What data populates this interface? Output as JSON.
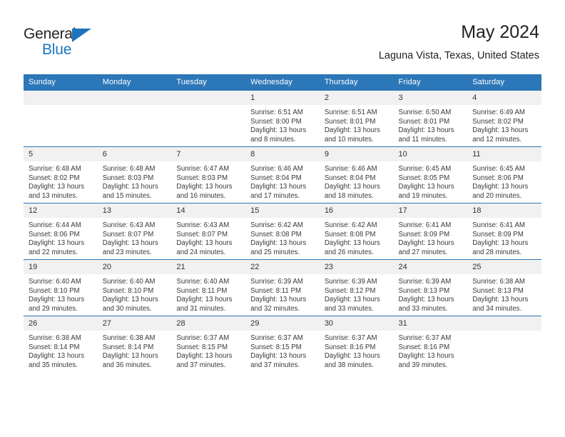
{
  "brand": {
    "name_part1": "General",
    "name_part2": "Blue",
    "color_primary": "#1c75bc",
    "color_text": "#231f20"
  },
  "header": {
    "title": "May 2024",
    "subtitle": "Laguna Vista, Texas, United States",
    "header_bg": "#2c77b8",
    "daynum_bg": "#f1f1f1"
  },
  "weekday_headers": [
    "Sunday",
    "Monday",
    "Tuesday",
    "Wednesday",
    "Thursday",
    "Friday",
    "Saturday"
  ],
  "labels": {
    "sunrise_prefix": "Sunrise:",
    "sunset_prefix": "Sunset:",
    "daylight_prefix": "Daylight:"
  },
  "weeks": [
    [
      {
        "day": "",
        "blank": true,
        "sunrise": "",
        "sunset": "",
        "daylight_line1": "",
        "daylight_line2": ""
      },
      {
        "day": "",
        "blank": true,
        "sunrise": "",
        "sunset": "",
        "daylight_line1": "",
        "daylight_line2": ""
      },
      {
        "day": "",
        "blank": true,
        "sunrise": "",
        "sunset": "",
        "daylight_line1": "",
        "daylight_line2": ""
      },
      {
        "day": "1",
        "blank": false,
        "sunrise": "Sunrise: 6:51 AM",
        "sunset": "Sunset: 8:00 PM",
        "daylight_line1": "Daylight: 13 hours",
        "daylight_line2": "and 8 minutes."
      },
      {
        "day": "2",
        "blank": false,
        "sunrise": "Sunrise: 6:51 AM",
        "sunset": "Sunset: 8:01 PM",
        "daylight_line1": "Daylight: 13 hours",
        "daylight_line2": "and 10 minutes."
      },
      {
        "day": "3",
        "blank": false,
        "sunrise": "Sunrise: 6:50 AM",
        "sunset": "Sunset: 8:01 PM",
        "daylight_line1": "Daylight: 13 hours",
        "daylight_line2": "and 11 minutes."
      },
      {
        "day": "4",
        "blank": false,
        "sunrise": "Sunrise: 6:49 AM",
        "sunset": "Sunset: 8:02 PM",
        "daylight_line1": "Daylight: 13 hours",
        "daylight_line2": "and 12 minutes."
      }
    ],
    [
      {
        "day": "5",
        "blank": false,
        "sunrise": "Sunrise: 6:48 AM",
        "sunset": "Sunset: 8:02 PM",
        "daylight_line1": "Daylight: 13 hours",
        "daylight_line2": "and 13 minutes."
      },
      {
        "day": "6",
        "blank": false,
        "sunrise": "Sunrise: 6:48 AM",
        "sunset": "Sunset: 8:03 PM",
        "daylight_line1": "Daylight: 13 hours",
        "daylight_line2": "and 15 minutes."
      },
      {
        "day": "7",
        "blank": false,
        "sunrise": "Sunrise: 6:47 AM",
        "sunset": "Sunset: 8:03 PM",
        "daylight_line1": "Daylight: 13 hours",
        "daylight_line2": "and 16 minutes."
      },
      {
        "day": "8",
        "blank": false,
        "sunrise": "Sunrise: 6:46 AM",
        "sunset": "Sunset: 8:04 PM",
        "daylight_line1": "Daylight: 13 hours",
        "daylight_line2": "and 17 minutes."
      },
      {
        "day": "9",
        "blank": false,
        "sunrise": "Sunrise: 6:46 AM",
        "sunset": "Sunset: 8:04 PM",
        "daylight_line1": "Daylight: 13 hours",
        "daylight_line2": "and 18 minutes."
      },
      {
        "day": "10",
        "blank": false,
        "sunrise": "Sunrise: 6:45 AM",
        "sunset": "Sunset: 8:05 PM",
        "daylight_line1": "Daylight: 13 hours",
        "daylight_line2": "and 19 minutes."
      },
      {
        "day": "11",
        "blank": false,
        "sunrise": "Sunrise: 6:45 AM",
        "sunset": "Sunset: 8:06 PM",
        "daylight_line1": "Daylight: 13 hours",
        "daylight_line2": "and 20 minutes."
      }
    ],
    [
      {
        "day": "12",
        "blank": false,
        "sunrise": "Sunrise: 6:44 AM",
        "sunset": "Sunset: 8:06 PM",
        "daylight_line1": "Daylight: 13 hours",
        "daylight_line2": "and 22 minutes."
      },
      {
        "day": "13",
        "blank": false,
        "sunrise": "Sunrise: 6:43 AM",
        "sunset": "Sunset: 8:07 PM",
        "daylight_line1": "Daylight: 13 hours",
        "daylight_line2": "and 23 minutes."
      },
      {
        "day": "14",
        "blank": false,
        "sunrise": "Sunrise: 6:43 AM",
        "sunset": "Sunset: 8:07 PM",
        "daylight_line1": "Daylight: 13 hours",
        "daylight_line2": "and 24 minutes."
      },
      {
        "day": "15",
        "blank": false,
        "sunrise": "Sunrise: 6:42 AM",
        "sunset": "Sunset: 8:08 PM",
        "daylight_line1": "Daylight: 13 hours",
        "daylight_line2": "and 25 minutes."
      },
      {
        "day": "16",
        "blank": false,
        "sunrise": "Sunrise: 6:42 AM",
        "sunset": "Sunset: 8:08 PM",
        "daylight_line1": "Daylight: 13 hours",
        "daylight_line2": "and 26 minutes."
      },
      {
        "day": "17",
        "blank": false,
        "sunrise": "Sunrise: 6:41 AM",
        "sunset": "Sunset: 8:09 PM",
        "daylight_line1": "Daylight: 13 hours",
        "daylight_line2": "and 27 minutes."
      },
      {
        "day": "18",
        "blank": false,
        "sunrise": "Sunrise: 6:41 AM",
        "sunset": "Sunset: 8:09 PM",
        "daylight_line1": "Daylight: 13 hours",
        "daylight_line2": "and 28 minutes."
      }
    ],
    [
      {
        "day": "19",
        "blank": false,
        "sunrise": "Sunrise: 6:40 AM",
        "sunset": "Sunset: 8:10 PM",
        "daylight_line1": "Daylight: 13 hours",
        "daylight_line2": "and 29 minutes."
      },
      {
        "day": "20",
        "blank": false,
        "sunrise": "Sunrise: 6:40 AM",
        "sunset": "Sunset: 8:10 PM",
        "daylight_line1": "Daylight: 13 hours",
        "daylight_line2": "and 30 minutes."
      },
      {
        "day": "21",
        "blank": false,
        "sunrise": "Sunrise: 6:40 AM",
        "sunset": "Sunset: 8:11 PM",
        "daylight_line1": "Daylight: 13 hours",
        "daylight_line2": "and 31 minutes."
      },
      {
        "day": "22",
        "blank": false,
        "sunrise": "Sunrise: 6:39 AM",
        "sunset": "Sunset: 8:11 PM",
        "daylight_line1": "Daylight: 13 hours",
        "daylight_line2": "and 32 minutes."
      },
      {
        "day": "23",
        "blank": false,
        "sunrise": "Sunrise: 6:39 AM",
        "sunset": "Sunset: 8:12 PM",
        "daylight_line1": "Daylight: 13 hours",
        "daylight_line2": "and 33 minutes."
      },
      {
        "day": "24",
        "blank": false,
        "sunrise": "Sunrise: 6:39 AM",
        "sunset": "Sunset: 8:13 PM",
        "daylight_line1": "Daylight: 13 hours",
        "daylight_line2": "and 33 minutes."
      },
      {
        "day": "25",
        "blank": false,
        "sunrise": "Sunrise: 6:38 AM",
        "sunset": "Sunset: 8:13 PM",
        "daylight_line1": "Daylight: 13 hours",
        "daylight_line2": "and 34 minutes."
      }
    ],
    [
      {
        "day": "26",
        "blank": false,
        "sunrise": "Sunrise: 6:38 AM",
        "sunset": "Sunset: 8:14 PM",
        "daylight_line1": "Daylight: 13 hours",
        "daylight_line2": "and 35 minutes."
      },
      {
        "day": "27",
        "blank": false,
        "sunrise": "Sunrise: 6:38 AM",
        "sunset": "Sunset: 8:14 PM",
        "daylight_line1": "Daylight: 13 hours",
        "daylight_line2": "and 36 minutes."
      },
      {
        "day": "28",
        "blank": false,
        "sunrise": "Sunrise: 6:37 AM",
        "sunset": "Sunset: 8:15 PM",
        "daylight_line1": "Daylight: 13 hours",
        "daylight_line2": "and 37 minutes."
      },
      {
        "day": "29",
        "blank": false,
        "sunrise": "Sunrise: 6:37 AM",
        "sunset": "Sunset: 8:15 PM",
        "daylight_line1": "Daylight: 13 hours",
        "daylight_line2": "and 37 minutes."
      },
      {
        "day": "30",
        "blank": false,
        "sunrise": "Sunrise: 6:37 AM",
        "sunset": "Sunset: 8:16 PM",
        "daylight_line1": "Daylight: 13 hours",
        "daylight_line2": "and 38 minutes."
      },
      {
        "day": "31",
        "blank": false,
        "sunrise": "Sunrise: 6:37 AM",
        "sunset": "Sunset: 8:16 PM",
        "daylight_line1": "Daylight: 13 hours",
        "daylight_line2": "and 39 minutes."
      },
      {
        "day": "",
        "blank": true,
        "sunrise": "",
        "sunset": "",
        "daylight_line1": "",
        "daylight_line2": ""
      }
    ]
  ]
}
